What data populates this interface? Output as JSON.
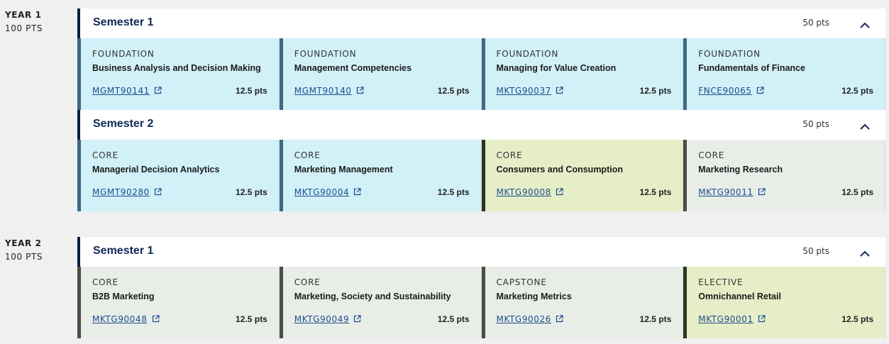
{
  "years": [
    {
      "label": "YEAR 1",
      "points": "100 PTS",
      "semesters": [
        {
          "title": "Semester 1",
          "points": "50 pts",
          "subjects": [
            {
              "type": "FOUNDATION",
              "name": "Business Analysis and Decision Making",
              "code": "MGMT90141",
              "points": "12.5 pts",
              "color": "blue"
            },
            {
              "type": "FOUNDATION",
              "name": "Management Competencies",
              "code": "MGMT90140",
              "points": "12.5 pts",
              "color": "blue"
            },
            {
              "type": "FOUNDATION",
              "name": "Managing for Value Creation",
              "code": "MKTG90037",
              "points": "12.5 pts",
              "color": "blue"
            },
            {
              "type": "FOUNDATION",
              "name": "Fundamentals of Finance",
              "code": "FNCE90065",
              "points": "12.5 pts",
              "color": "blue"
            }
          ]
        },
        {
          "title": "Semester 2",
          "points": "50 pts",
          "subjects": [
            {
              "type": "CORE",
              "name": "Managerial Decision Analytics",
              "code": "MGMT90280",
              "points": "12.5 pts",
              "color": "blue"
            },
            {
              "type": "CORE",
              "name": "Marketing Management",
              "code": "MKTG90004",
              "points": "12.5 pts",
              "color": "blue"
            },
            {
              "type": "CORE",
              "name": "Consumers and Consumption",
              "code": "MKTG90008",
              "points": "12.5 pts",
              "color": "green"
            },
            {
              "type": "CORE",
              "name": "Marketing Research",
              "code": "MKTG90011",
              "points": "12.5 pts",
              "color": "grey"
            }
          ]
        }
      ]
    },
    {
      "label": "YEAR 2",
      "points": "100 PTS",
      "semesters": [
        {
          "title": "Semester 1",
          "points": "50 pts",
          "subjects": [
            {
              "type": "CORE",
              "name": "B2B Marketing",
              "code": "MKTG90048",
              "points": "12.5 pts",
              "color": "grey"
            },
            {
              "type": "CORE",
              "name": "Marketing, Society and Sustainability",
              "code": "MKTG90049",
              "points": "12.5 pts",
              "color": "grey"
            },
            {
              "type": "CAPSTONE",
              "name": "Marketing Metrics",
              "code": "MKTG90026",
              "points": "12.5 pts",
              "color": "grey"
            },
            {
              "type": "ELECTIVE",
              "name": "Omnichannel Retail",
              "code": "MKTG90001",
              "points": "12.5 pts",
              "color": "green"
            }
          ]
        }
      ]
    }
  ],
  "icons": {
    "collapse": "chevron-up-icon",
    "external": "external-link-icon"
  }
}
